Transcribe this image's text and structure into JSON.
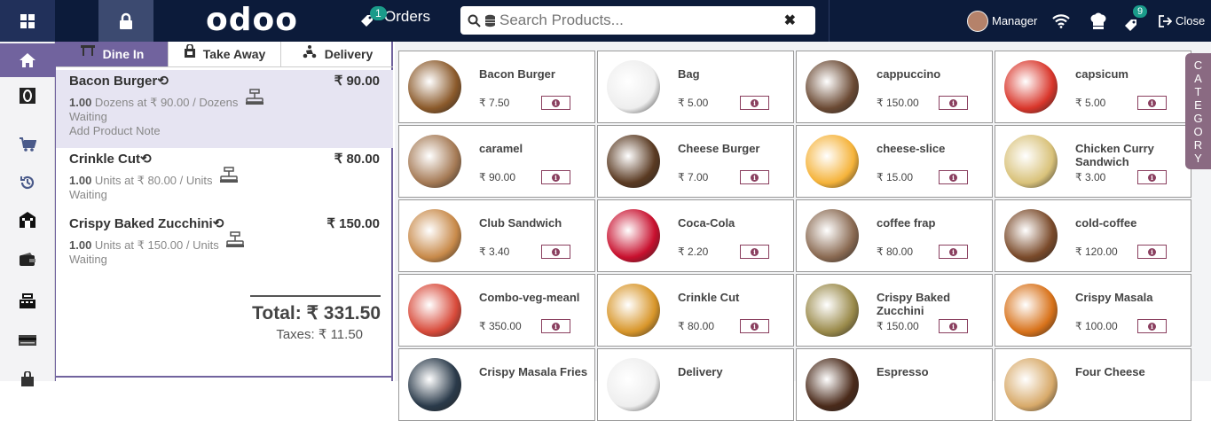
{
  "header": {
    "logo": "odoo",
    "orders_label": "Orders",
    "orders_count": "1",
    "search_placeholder": "Search Products...",
    "clear_icon": "✖",
    "user_name": "Manager",
    "notif_count": "9",
    "close_label": "Close"
  },
  "nav": {
    "items": [
      "home-icon",
      "odoo-app-icon",
      "cart-icon",
      "history-icon",
      "store-icon",
      "wallet-icon",
      "register-icon",
      "card-icon",
      "bag-icon"
    ]
  },
  "order": {
    "tabs": [
      {
        "label": "Dine In",
        "icon": "table-icon"
      },
      {
        "label": "Take Away",
        "icon": "bag-icon"
      },
      {
        "label": "Delivery",
        "icon": "delivery-icon"
      }
    ],
    "lines": [
      {
        "name": "Bacon Burger",
        "price": "₹ 90.00",
        "qty": "1.00",
        "detail": " Dozens at ₹ 90.00 / Dozens",
        "status": "Waiting",
        "note": "Add Product Note"
      },
      {
        "name": "Crinkle Cut",
        "price": "₹ 80.00",
        "qty": "1.00",
        "detail": " Units at ₹ 80.00 / Units",
        "status": "Waiting"
      },
      {
        "name": "Crispy Baked Zucchini",
        "price": "₹ 150.00",
        "qty": "1.00",
        "detail": " Units at ₹ 150.00 / Units",
        "status": "Waiting"
      }
    ],
    "total": "Total: ₹ 331.50",
    "taxes": "Taxes: ₹ 11.50"
  },
  "category_label": [
    "C",
    "A",
    "T",
    "E",
    "G",
    "O",
    "R",
    "Y"
  ],
  "products": [
    {
      "name": "Bacon Burger",
      "price": "₹ 7.50",
      "color": "#8b5a2b"
    },
    {
      "name": "Bag",
      "price": "₹ 5.00",
      "color": "#eeeeee"
    },
    {
      "name": "cappuccino",
      "price": "₹ 150.00",
      "color": "#6b4a34"
    },
    {
      "name": "capsicum",
      "price": "₹ 5.00",
      "color": "#d9362b"
    },
    {
      "name": "caramel",
      "price": "₹ 90.00",
      "color": "#a57a55"
    },
    {
      "name": "Cheese Burger",
      "price": "₹ 7.00",
      "color": "#5a3a22"
    },
    {
      "name": "cheese-slice",
      "price": "₹ 15.00",
      "color": "#f5b33a"
    },
    {
      "name": "Chicken Curry Sandwich",
      "price": "₹ 3.00",
      "color": "#d9c27a"
    },
    {
      "name": "Club Sandwich",
      "price": "₹ 3.40",
      "color": "#c88a4a"
    },
    {
      "name": "Coca-Cola",
      "price": "₹ 2.20",
      "color": "#c8102e"
    },
    {
      "name": "coffee frap",
      "price": "₹ 80.00",
      "color": "#8a6a52"
    },
    {
      "name": "cold-coffee",
      "price": "₹ 120.00",
      "color": "#7a4a2a"
    },
    {
      "name": "Combo-veg-meanl",
      "price": "₹ 350.00",
      "color": "#d84a3a"
    },
    {
      "name": "Crinkle Cut",
      "price": "₹ 80.00",
      "color": "#d8962a"
    },
    {
      "name": "Crispy Baked Zucchini",
      "price": "₹ 150.00",
      "color": "#9a8a4a"
    },
    {
      "name": "Crispy Masala",
      "price": "₹ 100.00",
      "color": "#d8721a"
    },
    {
      "name": "Crispy Masala Fries",
      "price": "",
      "color": "#2a3a4a"
    },
    {
      "name": "Delivery",
      "price": "",
      "color": "#eeeeee"
    },
    {
      "name": "Espresso",
      "price": "",
      "color": "#4a2a1a"
    },
    {
      "name": "Four Cheese",
      "price": "",
      "color": "#d8aa6a"
    }
  ]
}
